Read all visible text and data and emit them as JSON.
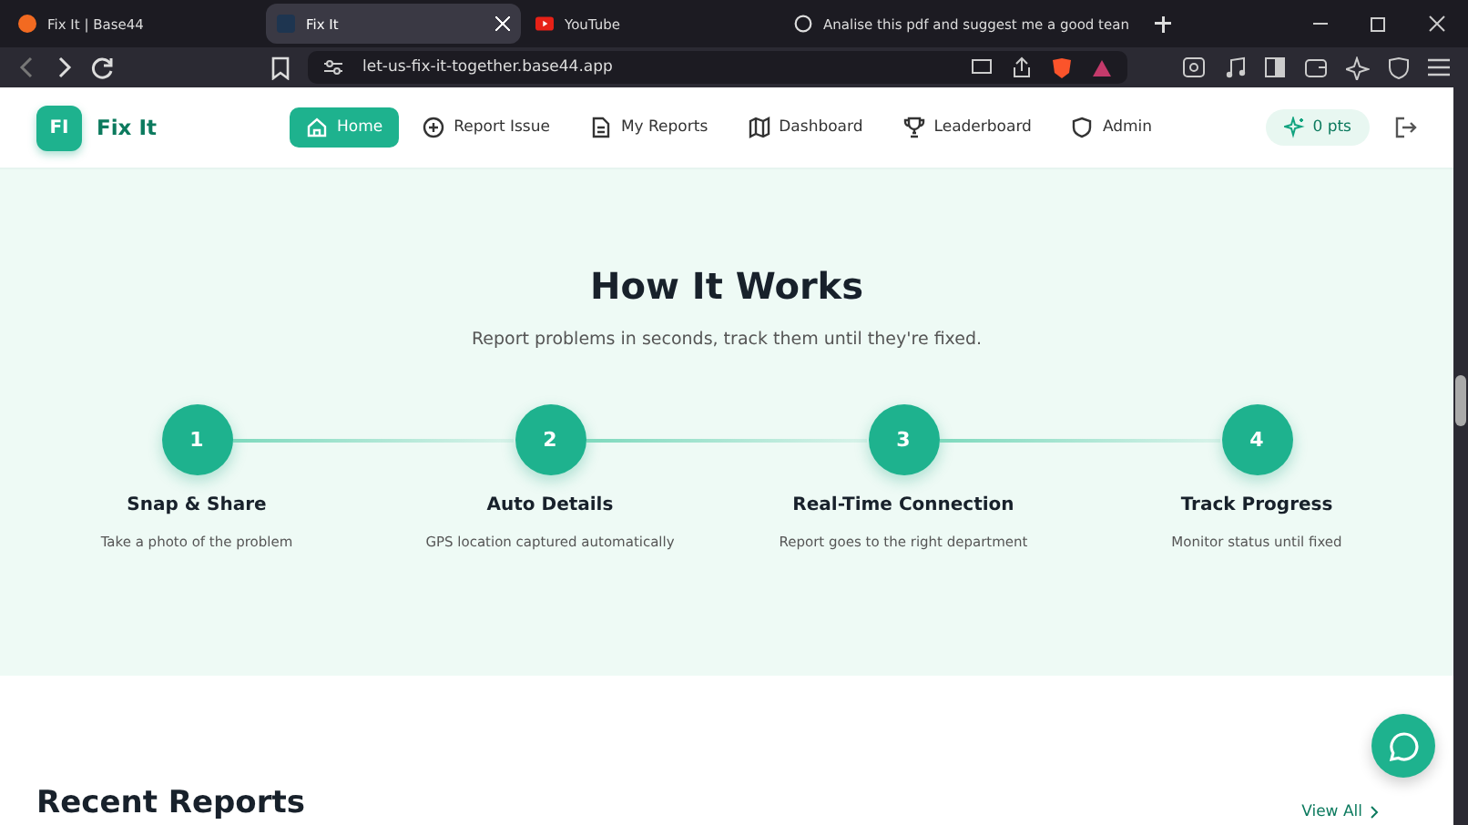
{
  "browser": {
    "tabs": [
      {
        "title": "Fix It | Base44",
        "selected": false,
        "kind": "base44"
      },
      {
        "title": "Fix It",
        "selected": true,
        "kind": "fixit"
      },
      {
        "title": "YouTube",
        "selected": false,
        "kind": "youtube"
      },
      {
        "title": "Analise this pdf and suggest me a good tean",
        "selected": false,
        "kind": "chat"
      }
    ],
    "url": "let-us-fix-it-together.base44.app"
  },
  "header": {
    "logo_mark": "FI",
    "logo_text": "Fix It",
    "nav": [
      {
        "label": "Home",
        "kind": "home",
        "selected": true
      },
      {
        "label": "Report Issue",
        "kind": "plus",
        "selected": false
      },
      {
        "label": "My Reports",
        "kind": "doc",
        "selected": false
      },
      {
        "label": "Dashboard",
        "kind": "map",
        "selected": false
      },
      {
        "label": "Leaderboard",
        "kind": "trophy",
        "selected": false
      },
      {
        "label": "Admin",
        "kind": "shield",
        "selected": false
      }
    ],
    "points": "0 pts"
  },
  "how_it_works": {
    "title": "How It Works",
    "subtitle": "Report problems in seconds, track them until they're fixed.",
    "steps": [
      {
        "number": "1",
        "title": "Snap & Share",
        "text": "Take a photo of the problem"
      },
      {
        "number": "2",
        "title": "Auto Details",
        "text": "GPS location captured automatically"
      },
      {
        "number": "3",
        "title": "Real-Time Connection",
        "text": "Report goes to the right department"
      },
      {
        "number": "4",
        "title": "Track Progress",
        "text": "Monitor status until fixed"
      }
    ]
  },
  "recent": {
    "title": "Recent Reports",
    "link": "View All"
  }
}
